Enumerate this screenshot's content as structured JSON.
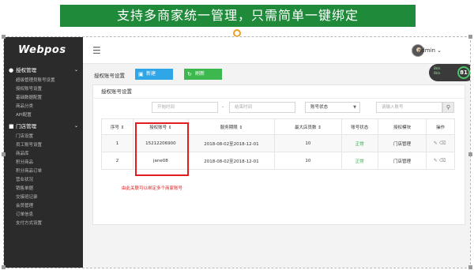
{
  "banner": {
    "text": "支持多商家统一管理，只需简单一键绑定"
  },
  "brand": {
    "logo": "Webpos"
  },
  "sidebar": {
    "groups": [
      {
        "label": "授权管理",
        "items": [
          "超级管理员账号设置",
          "授权账号设置",
          "基础数据配置",
          "商品分类",
          "API配置"
        ]
      },
      {
        "label": "门店管理",
        "items": [
          "门店设置",
          "员工账号设置",
          "商品库",
          "积分商品",
          "积分商品订单",
          "营业状况",
          "销售单据",
          "交接班记录",
          "会员管理",
          "订单信息",
          "支付方式设置"
        ]
      }
    ]
  },
  "header": {
    "user": "admin",
    "gauge_value": "81",
    "gauge_k1": "0k/s",
    "gauge_k2": "0k/s"
  },
  "toolbar": {
    "title": "授权账号设置",
    "new_label": "新建",
    "refresh_label": "刷新"
  },
  "panel": {
    "title": "授权账号设置"
  },
  "filters": {
    "start_placeholder": "开始时间",
    "dash": "-",
    "end_placeholder": "结束时间",
    "status_value": "账号状态",
    "search_placeholder": "请输入账号"
  },
  "table": {
    "headers": [
      "序号",
      "授权账号",
      "服务期限",
      "最大店员数",
      "账号状态",
      "授权模块",
      "操作"
    ],
    "rows": [
      {
        "index": "1",
        "account": "15212206900",
        "period": "2018-08-02至2018-12-01",
        "max_staff": "10",
        "status": "正常",
        "module": "门店管理"
      },
      {
        "index": "2",
        "account": "jane08",
        "period": "2018-08-02至2018-12-01",
        "max_staff": "10",
        "status": "正常",
        "module": "门店管理"
      }
    ]
  },
  "annotation": {
    "text": "由此关联可以绑定多个商家账号"
  },
  "colors": {
    "banner": "#1e8a3a",
    "sidebar": "#2b2b2b",
    "new_button": "#2ea6e8",
    "refresh_button": "#3cb84f",
    "status_ok": "#39a84e",
    "annotation": "#e11d1d"
  }
}
